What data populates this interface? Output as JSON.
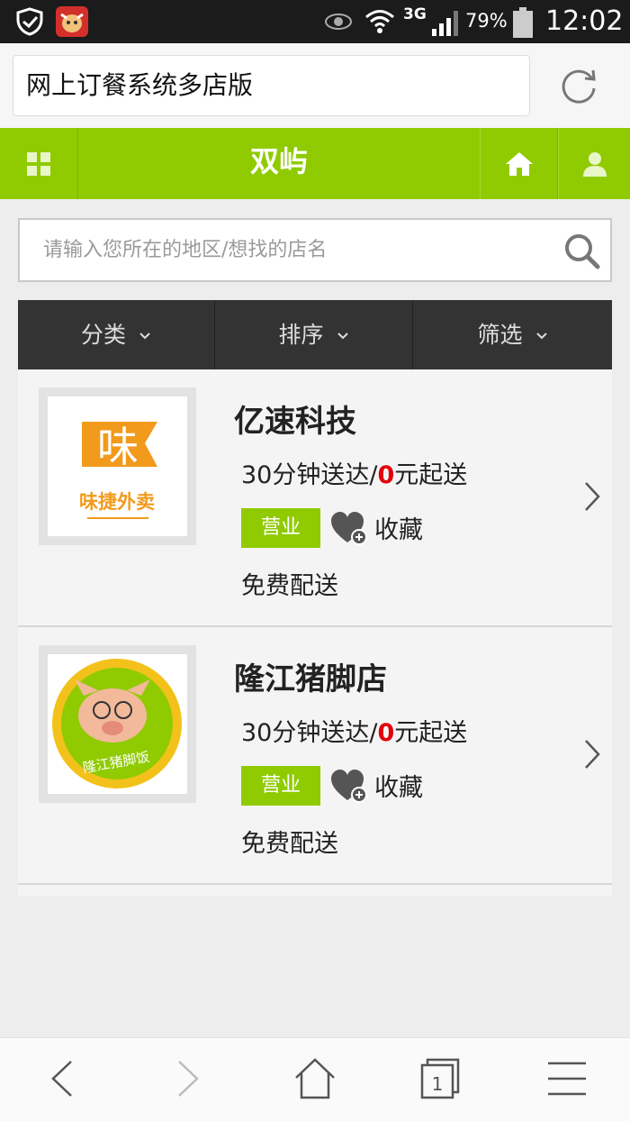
{
  "status_bar": {
    "network": "3G",
    "battery_percent": "79%",
    "time": "12:02"
  },
  "browser": {
    "url_title": "网上订餐系统多店版"
  },
  "nav": {
    "title": "双屿"
  },
  "search": {
    "placeholder": "请输入您所在的地区/想找的店名"
  },
  "filters": [
    {
      "label": "分类"
    },
    {
      "label": "排序"
    },
    {
      "label": "筛选"
    }
  ],
  "shops": [
    {
      "name": "亿速科技",
      "delivery_prefix": "30分钟送达/",
      "min_order": "0",
      "delivery_suffix": "元起送",
      "status": "营业",
      "favorite_label": "收藏",
      "shipping": "免费配送",
      "logo_text": "味捷外卖",
      "logo_glyph": "味"
    },
    {
      "name": "隆江猪脚店",
      "delivery_prefix": "30分钟送达/",
      "min_order": "0",
      "delivery_suffix": "元起送",
      "status": "营业",
      "favorite_label": "收藏",
      "shipping": "免费配送",
      "logo_text": "隆江猪脚饭"
    }
  ],
  "colors": {
    "accent_green": "#8fcb00",
    "filter_bar": "#333333",
    "price_red": "#e3000b"
  }
}
